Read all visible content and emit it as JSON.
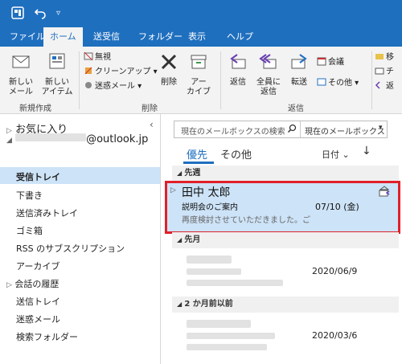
{
  "ribbon_tabs": [
    "ファイル",
    "ホーム",
    "送受信",
    "フォルダー",
    "表示",
    "ヘルプ"
  ],
  "ribbon": {
    "new_mail": "新しい\nメール",
    "new_items": "新しい\nアイテム",
    "group_new": "新規作成",
    "ignore": "無視",
    "cleanup": "クリーンアップ",
    "junk": "迷惑メール",
    "delete": "削除",
    "archive": "アー\nカイブ",
    "group_delete": "削除",
    "reply": "返信",
    "reply_all": "全員に\n返信",
    "forward": "転送",
    "meeting": "会議",
    "more": "その他",
    "group_respond": "返信",
    "right_items": [
      "移",
      "チ",
      "返"
    ]
  },
  "nav": {
    "favorites": "お気に入り",
    "account": "@outlook.jp",
    "folders": [
      "受信トレイ",
      "下書き",
      "送信済みトレイ",
      "ゴミ箱",
      "RSS のサブスクリプション",
      "アーカイブ",
      "会話の履歴",
      "送信トレイ",
      "迷惑メール",
      "検索フォルダー"
    ]
  },
  "search": {
    "placeholder": "現在のメールボックスの検索",
    "scope": "現在のメールボックス"
  },
  "list_header": {
    "focused": "優先",
    "other": "その他",
    "sort": "日付"
  },
  "sections": [
    "先週",
    "先月",
    "2 か月前以前"
  ],
  "messages": [
    {
      "from": "田中 太郎",
      "subject": "説明会のご案内",
      "preview": "再度検討させていただきました。ご",
      "date": "07/10 (金)"
    },
    {
      "from": "",
      "subject": "",
      "preview": "",
      "date": "2020/06/9"
    },
    {
      "from": "",
      "subject": "",
      "preview": "",
      "date": "2020/03/6"
    }
  ]
}
